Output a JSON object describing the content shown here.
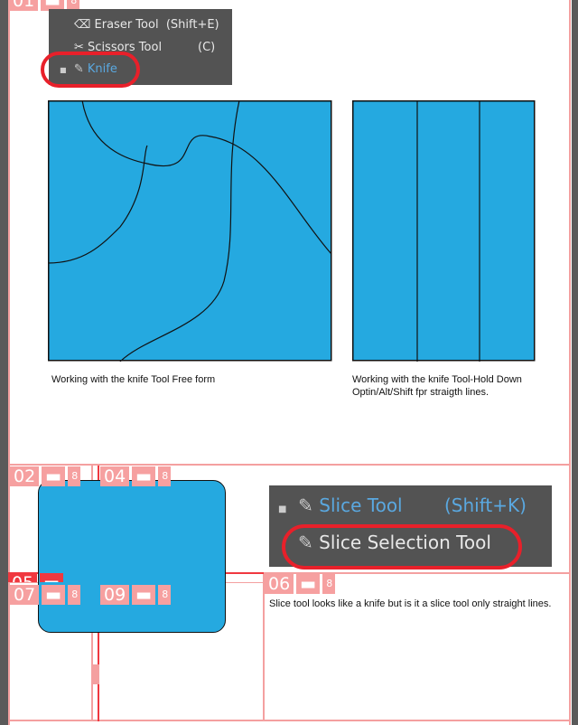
{
  "menu1": {
    "items": [
      {
        "label": "Eraser Tool",
        "shortcut": "(Shift+E)",
        "icon": "eraser-icon"
      },
      {
        "label": "Scissors Tool",
        "shortcut": "(C)",
        "icon": "scissors-icon"
      },
      {
        "label": "Knife",
        "shortcut": "",
        "icon": "knife-icon",
        "selected": true
      }
    ]
  },
  "menu2": {
    "items": [
      {
        "label": "Slice Tool",
        "shortcut": "(Shift+K)",
        "icon": "slice-icon",
        "selected": true
      },
      {
        "label": "Slice Selection Tool",
        "shortcut": "",
        "icon": "slice-selection-icon"
      }
    ]
  },
  "captions": {
    "freeform": "Working with the knife Tool Free form",
    "straight": "Working with the knife Tool-Hold Down Optin/Alt/Shift fpr straigth lines.",
    "slice": "Slice tool looks like a knife but is it a slice tool only straight lines."
  },
  "slices": {
    "s01": "01",
    "s02": "02",
    "s04": "04",
    "s05": "05",
    "s06": "06",
    "s07": "07",
    "s09": "09"
  },
  "colors": {
    "fill": "#25a9e0",
    "slice_line": "#f4a0a0",
    "highlight": "#e8202a"
  }
}
